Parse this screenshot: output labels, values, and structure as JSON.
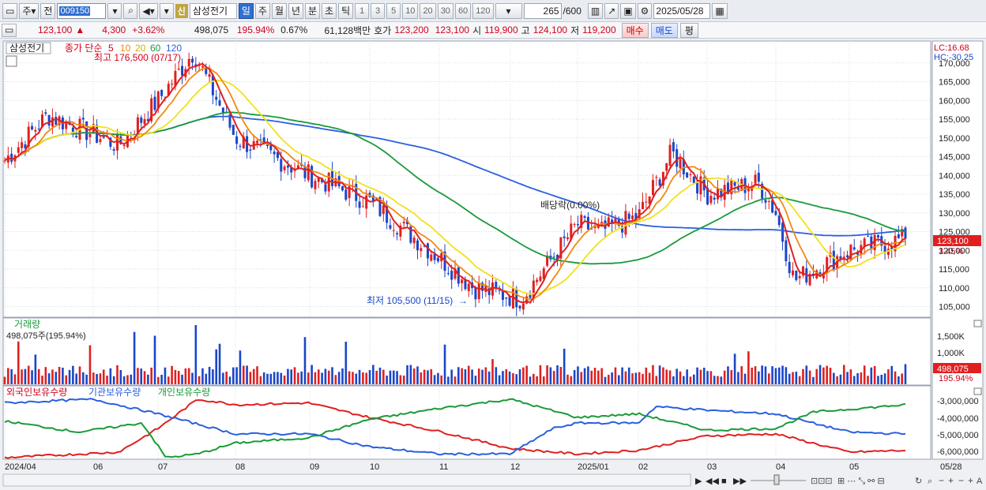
{
  "toolbar": {
    "period_main": "주",
    "prefix": "전",
    "code": "009150",
    "badge": "신",
    "stock_name": "삼성전기",
    "periods": [
      "일",
      "주",
      "월",
      "년",
      "분",
      "초",
      "틱"
    ],
    "active_period": "일",
    "minute_steps": [
      "1",
      "3",
      "5",
      "10",
      "20",
      "30",
      "60",
      "120"
    ],
    "count": "265",
    "total": "/600",
    "date": "2025/05/28"
  },
  "infobar": {
    "price": "123,100",
    "arrow": "▲",
    "change": "4,300",
    "change_rate": "+3.62%",
    "volume": "498,075",
    "volume_ratio": "195.94%",
    "turnover": "0.67%",
    "amount": "61,128백만",
    "ask_label": "호가",
    "ask1": "123,200",
    "ask2": "123,100",
    "open_label": "시",
    "open": "119,900",
    "high_label": "고",
    "high": "124,100",
    "low_label": "저",
    "low": "119,200",
    "buy": "매수",
    "sell": "매도",
    "eval": "평"
  },
  "price_panel": {
    "stock_label": "삼성전기",
    "ma_label": "종가 단순",
    "ma_periods": [
      "5",
      "10",
      "20",
      "60",
      "120"
    ],
    "ma_colors": [
      "#e02020",
      "#f08a10",
      "#f2e11a",
      "#1a9a3a",
      "#2a5fe0"
    ],
    "high_note": "최고 176,500 (07/17)",
    "low_note": "최저 105,500 (11/15)",
    "dividend_note": "배당락(0.00%)",
    "lc": "LC:16.68",
    "hc": "HC:-30.25",
    "price_tag": "123,100",
    "price_pct": "3.45%",
    "y_ticks": [
      "170,000",
      "165,000",
      "160,000",
      "155,000",
      "150,000",
      "145,000",
      "140,000",
      "135,000",
      "130,000",
      "125,000",
      "120,000",
      "115,000",
      "110,000",
      "105,000"
    ]
  },
  "volume_panel": {
    "title": "거래량",
    "value": "498,075주(195.94%)",
    "y_ticks": [
      "1,500K",
      "1,000K"
    ],
    "tag": "498,075",
    "tag_pct": "195.94%"
  },
  "holding_panel": {
    "legend": [
      "외국인보유수량",
      "기관보유수량",
      "개인보유수량"
    ],
    "colors": [
      "#e02020",
      "#2a5fe0",
      "#1a9a3a"
    ],
    "y_ticks": [
      "-3,000,000",
      "-4,000,000",
      "-5,000,000",
      "-6,000,000"
    ]
  },
  "x_axis": {
    "labels": [
      "2024/04",
      "06",
      "07",
      "08",
      "09",
      "10",
      "11",
      "12",
      "2025/01",
      "02",
      "03",
      "04",
      "05",
      "05/28"
    ]
  },
  "chart_data": {
    "type": "candlestick",
    "x_range": [
      "2024/04",
      "2025/05/28"
    ],
    "y_range": [
      103000,
      175000
    ],
    "price_series_close": [
      {
        "x": "2024/04",
        "y": 144000
      },
      {
        "x": "05",
        "y": 155000
      },
      {
        "x": "06",
        "y": 151000
      },
      {
        "x": "07",
        "y": 172000
      },
      {
        "x": "08",
        "y": 143000
      },
      {
        "x": "09",
        "y": 135000
      },
      {
        "x": "10",
        "y": 132000
      },
      {
        "x": "11",
        "y": 110000
      },
      {
        "x": "12",
        "y": 108000
      },
      {
        "x": "2025/01",
        "y": 128000
      },
      {
        "x": "02",
        "y": 146000
      },
      {
        "x": "03",
        "y": 137000
      },
      {
        "x": "04",
        "y": 114000
      },
      {
        "x": "05",
        "y": 120000
      },
      {
        "x": "05/28",
        "y": 123100
      }
    ],
    "ma120": [
      {
        "x": "2024/04",
        "y": 143500
      },
      {
        "x": "07",
        "y": 148000
      },
      {
        "x": "09",
        "y": 151000
      },
      {
        "x": "11",
        "y": 143000
      },
      {
        "x": "2025/01",
        "y": 130000
      },
      {
        "x": "02",
        "y": 126000
      },
      {
        "x": "05/28",
        "y": 126500
      }
    ],
    "ma60": [
      {
        "x": "2024/04",
        "y": 144000
      },
      {
        "x": "07",
        "y": 154000
      },
      {
        "x": "09",
        "y": 150000
      },
      {
        "x": "11",
        "y": 130000
      },
      {
        "x": "2025/01",
        "y": 120000
      },
      {
        "x": "02",
        "y": 124000
      },
      {
        "x": "03",
        "y": 134000
      },
      {
        "x": "04",
        "y": 134000
      },
      {
        "x": "05/28",
        "y": 127000
      }
    ],
    "volume_max": 1500000
  }
}
